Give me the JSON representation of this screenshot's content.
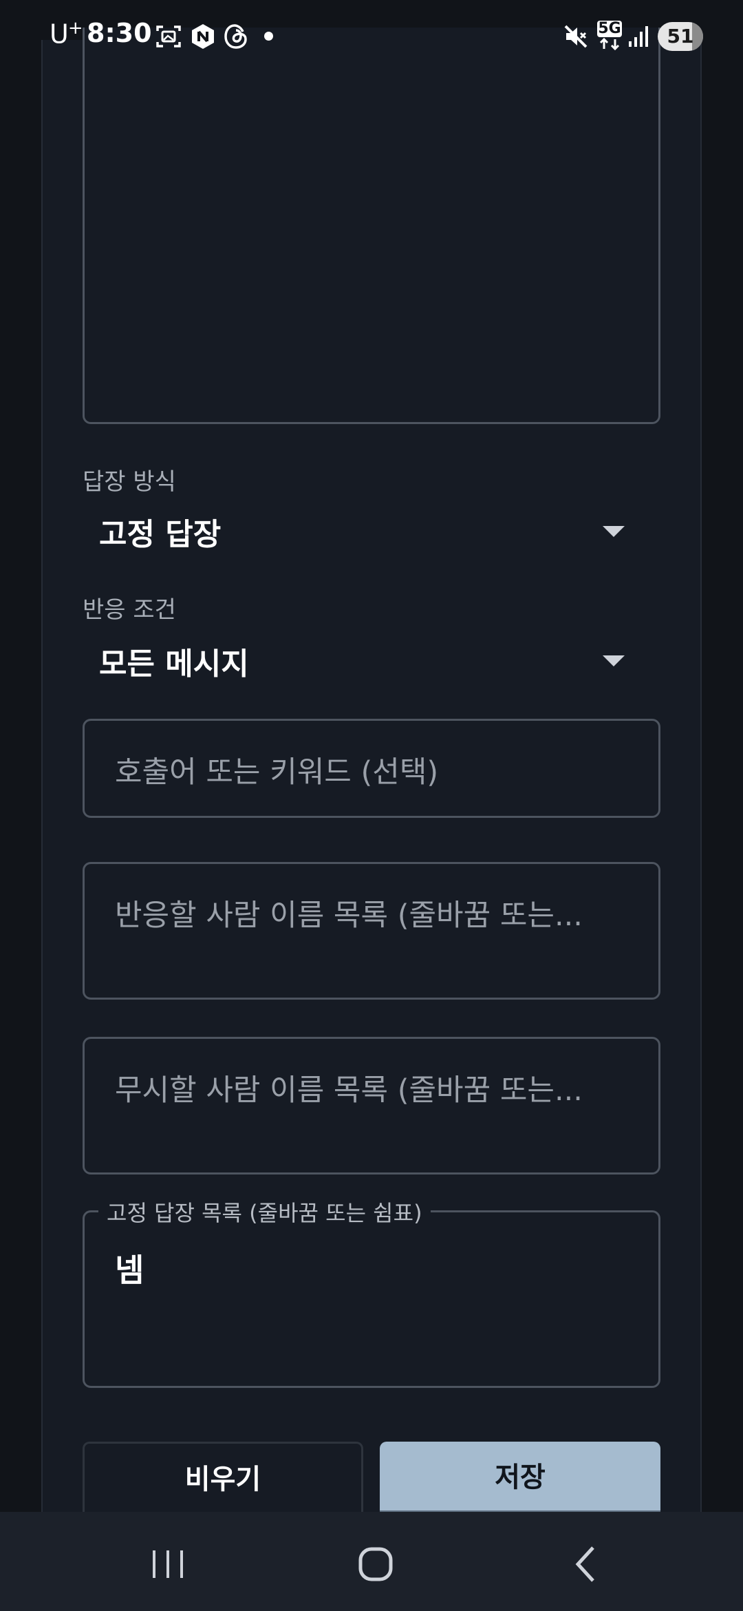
{
  "status_bar": {
    "carrier": "U",
    "carrier_sup": "+",
    "time": "8:30",
    "network": "5G",
    "battery": "51",
    "icons": [
      "screenshot-icon",
      "naver-icon",
      "threads-icon",
      "mute-icon",
      "signal-icon"
    ]
  },
  "form": {
    "reply_mode": {
      "label": "답장 방식",
      "value": "고정 답장"
    },
    "trigger_condition": {
      "label": "반응 조건",
      "value": "모든 메시지"
    },
    "keyword_input": {
      "placeholder": "호출어 또는 키워드 (선택)"
    },
    "respond_names": {
      "placeholder": "반응할 사람 이름 목록 (줄바꿈 또는..."
    },
    "ignore_names": {
      "placeholder": "무시할 사람 이름 목록 (줄바꿈 또는..."
    },
    "fixed_replies": {
      "label": "고정 답장 목록 (줄바꿈 또는 쉼표)",
      "value": "넴"
    }
  },
  "actions": {
    "clear_label": "비우기",
    "save_label": "저장"
  },
  "colors": {
    "background": "#111419",
    "card": "#161b24",
    "border": "#4d545f",
    "save_button": "#a5bbcf"
  },
  "nav": {
    "items": [
      "recent-apps-icon",
      "home-icon",
      "back-icon"
    ]
  }
}
